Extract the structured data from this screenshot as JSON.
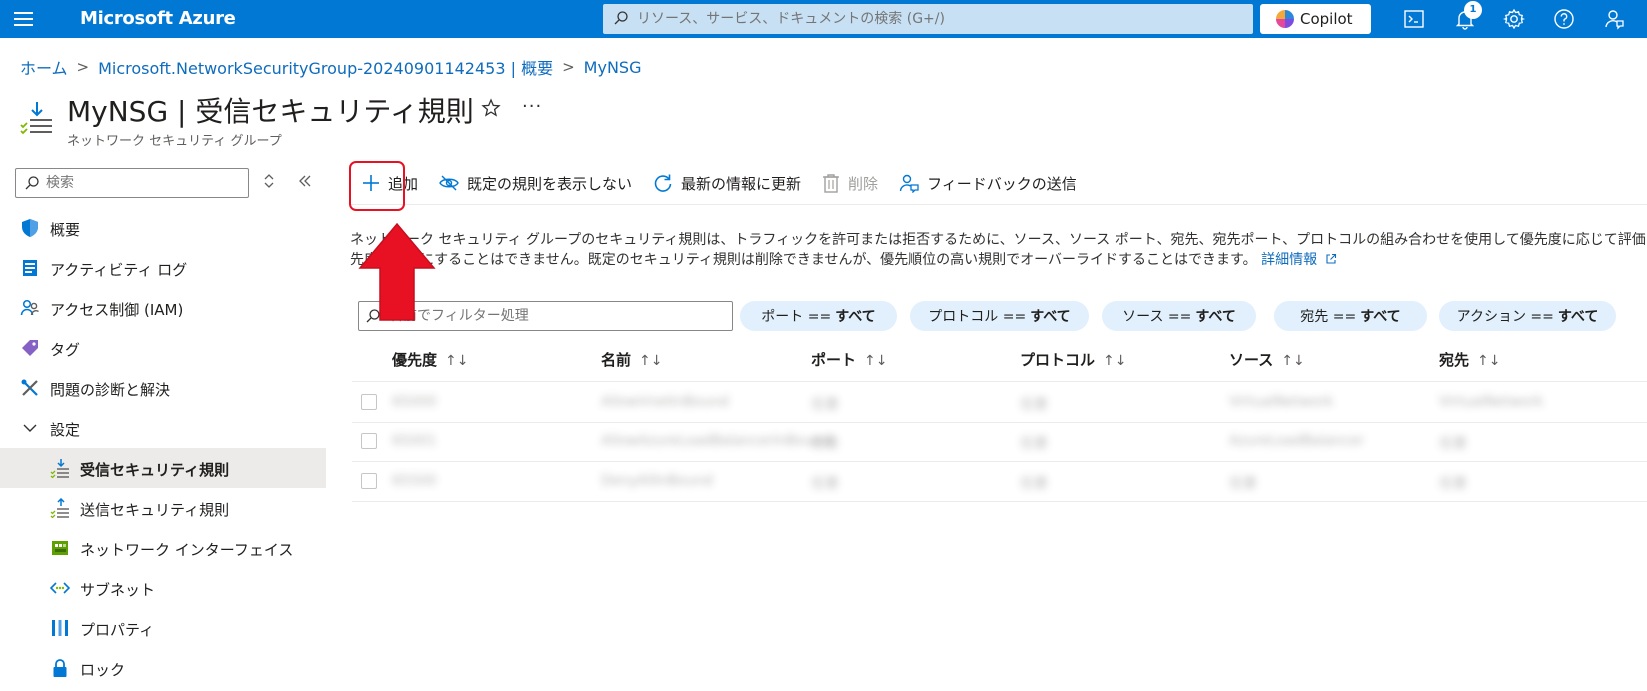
{
  "topbar": {
    "brand": "Microsoft Azure",
    "search_placeholder": "リソース、サービス、ドキュメントの検索 (G+/)",
    "copilot_label": "Copilot",
    "notification_count": "1",
    "background_color": "#0078d4",
    "icons": [
      "menu-icon",
      "cloud-shell-icon",
      "bell-icon",
      "gear-icon",
      "help-icon",
      "feedback-person-icon"
    ]
  },
  "breadcrumb": {
    "items": [
      "ホーム",
      "Microsoft.NetworkSecurityGroup-20240901142453 | 概要",
      "MyNSG"
    ]
  },
  "header": {
    "title": "MyNSG | 受信セキュリティ規則",
    "subtitle": "ネットワーク セキュリティ グループ"
  },
  "sidebar": {
    "search_placeholder": "検索",
    "items": [
      {
        "label": "概要",
        "icon": "shield-icon"
      },
      {
        "label": "アクティビティ ログ",
        "icon": "activity-log-icon"
      },
      {
        "label": "アクセス制御 (IAM)",
        "icon": "people-icon"
      },
      {
        "label": "タグ",
        "icon": "tag-icon"
      },
      {
        "label": "問題の診断と解決",
        "icon": "wrench-icon"
      },
      {
        "label": "設定",
        "icon": "chevron-down-icon"
      },
      {
        "label": "受信セキュリティ規則",
        "icon": "inbound-rules-icon"
      },
      {
        "label": "送信セキュリティ規則",
        "icon": "outbound-rules-icon"
      },
      {
        "label": "ネットワーク インターフェイス",
        "icon": "network-interface-icon"
      },
      {
        "label": "サブネット",
        "icon": "subnet-icon"
      },
      {
        "label": "プロパティ",
        "icon": "properties-icon"
      },
      {
        "label": "ロック",
        "icon": "lock-icon"
      }
    ]
  },
  "toolbar": {
    "add": "追加",
    "hide_default": "既定の規則を表示しない",
    "refresh": "最新の情報に更新",
    "delete": "削除",
    "feedback": "フィードバックの送信"
  },
  "description": {
    "line1": "ネットワーク セキュリティ グループのセキュリティ規則は、トラフィックを許可または拒否するために、ソース、ソース ポート、宛先、宛先ポート、プロトコルの組み合わせを使用して優先度に応じて評価されます。セキュリティ規則には、同じ優",
    "line2": "先度と方向にすることはできません。既定のセキュリティ規則は削除できませんが、優先順位の高い規則でオーバーライドすることはできます。",
    "link": "詳細情報"
  },
  "filters": {
    "name_placeholder": "名前でフィルター処理",
    "pills": [
      {
        "key": "ポート ==",
        "value": "すべて"
      },
      {
        "key": "プロトコル ==",
        "value": "すべて"
      },
      {
        "key": "ソース ==",
        "value": "すべて"
      },
      {
        "key": "宛先 ==",
        "value": "すべて"
      },
      {
        "key": "アクション ==",
        "value": "すべて"
      }
    ]
  },
  "table": {
    "columns": [
      "優先度",
      "名前",
      "ポート",
      "プロトコル",
      "ソース",
      "宛先"
    ],
    "rows": [
      [
        "65000",
        "AllowVnetInBound",
        "任意",
        "任意",
        "VirtualNetwork",
        "VirtualNetwork"
      ],
      [
        "65001",
        "AllowAzureLoadBalancerInBound",
        "任意",
        "任意",
        "AzureLoadBalancer",
        "任意"
      ],
      [
        "65500",
        "DenyAllInBound",
        "任意",
        "任意",
        "任意",
        "任意"
      ]
    ]
  },
  "annotation": {
    "highlight_color": "#e81123"
  }
}
